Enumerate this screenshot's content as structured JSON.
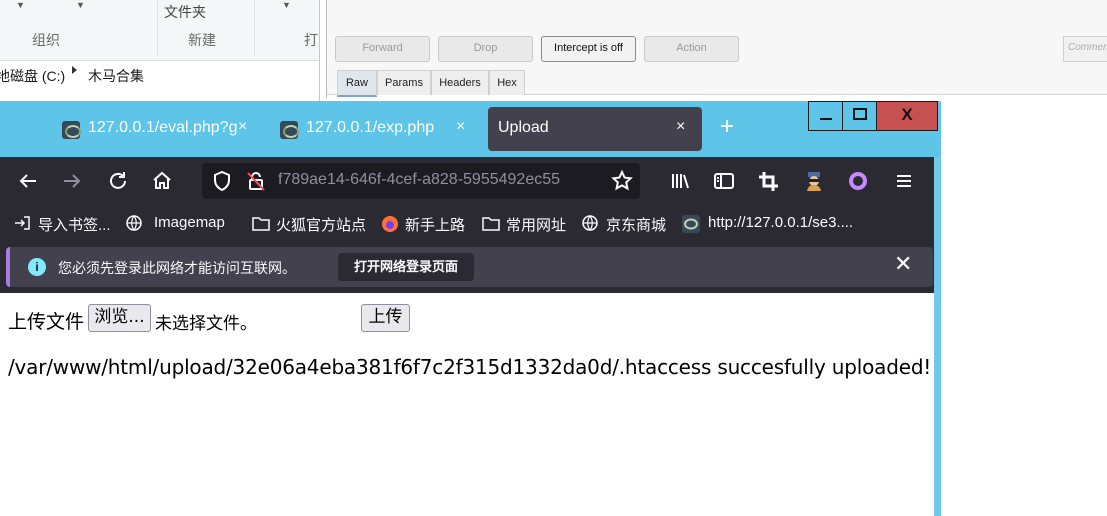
{
  "explorer": {
    "folder_label": "文件夹",
    "group_organize": "组织",
    "group_new": "新建",
    "group_open_partial": "打",
    "path_drive": "地磁盘 (C:)",
    "path_folder": "木马合集"
  },
  "burp": {
    "buttons": [
      "Forward",
      "Drop",
      "Intercept is off",
      "Action"
    ],
    "tabs": [
      "Raw",
      "Params",
      "Headers",
      "Hex"
    ],
    "comment_placeholder": "Comment"
  },
  "browser": {
    "tabs": [
      {
        "title": "127.0.0.1/eval.php?g",
        "close": "×"
      },
      {
        "title": "127.0.0.1/exp.php",
        "close": "×"
      },
      {
        "title": "Upload",
        "close": "×"
      }
    ],
    "new_tab": "+",
    "window_close": "X",
    "url": "f789ae14-646f-4cef-a828-5955492ec55",
    "toolbar_icons": [
      "back-icon",
      "forward-icon",
      "reload-icon",
      "home-icon",
      "shield-icon",
      "insecure-lock-icon",
      "bookmark-star-icon",
      "library-icon",
      "sidebar-icon",
      "screenshot-icon",
      "extension-spy-icon",
      "account-icon",
      "menu-icon"
    ],
    "bookmarks": [
      "导入书签...",
      "Imagemap",
      "火狐官方站点",
      "新手上路",
      "常用网址",
      "京东商城",
      "http://127.0.0.1/se3...."
    ],
    "notification": {
      "message": "您必须先登录此网络才能访问互联网。",
      "button": "打开网络登录页面",
      "close": "✕"
    }
  },
  "page": {
    "upload_label": "上传文件",
    "browse_button": "浏览...",
    "no_file_selected": "未选择文件。",
    "upload_button": "上传",
    "result_message": "/var/www/html/upload/32e06a4eba381f6f7c2f315d1332da0d/.htaccess succesfully uploaded!"
  },
  "colors": {
    "titlebar": "#5ec4e8",
    "toolbar": "#2b2a33",
    "close_button": "#c75050"
  }
}
